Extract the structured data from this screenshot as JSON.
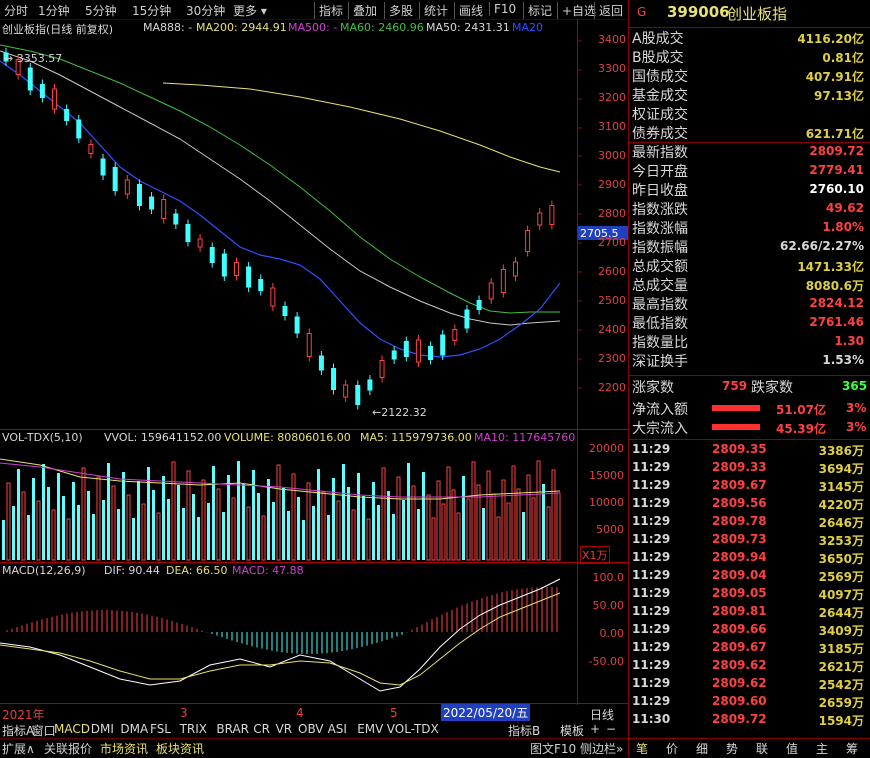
{
  "toolbar": {
    "left": [
      "分时",
      "1分钟",
      "5分钟",
      "15分钟",
      "30分钟",
      "更多"
    ],
    "right": [
      "指标",
      "叠加",
      "多股",
      "统计",
      "画线",
      "F10",
      "标记",
      "+自选",
      "返回"
    ]
  },
  "main": {
    "title": "创业板指(日线 前复权)",
    "ma888": "MA888: -",
    "ma200": "MA200: 2944.91",
    "ma500": "MA500: -",
    "ma60": "MA60: 2460.96",
    "ma50": "MA50: 2431.31",
    "ma20": "MA20",
    "yticks": [
      "3400",
      "3300",
      "3200",
      "3100",
      "3000",
      "2900",
      "2800",
      "2700",
      "2600",
      "2500",
      "2400",
      "2300",
      "2200"
    ],
    "high_label": "3353.57",
    "low_label": "2122.32",
    "current": "2705.5"
  },
  "vol": {
    "title": "VOL-TDX(5,10)",
    "vvol": "VVOL: 159641152.00",
    "volume": "VOLUME: 80806016.00",
    "ma5": "MA5: 115979736.00",
    "ma10": "MA10: 117645760.0",
    "yticks": [
      "20000",
      "15000",
      "10000",
      "5000"
    ],
    "unit": "X1万"
  },
  "macd": {
    "title": "MACD(12,26,9)",
    "dif": "DIF: 90.44",
    "dea": "DEA: 66.50",
    "macd": "MACD: 47.88",
    "yticks": [
      "100.0",
      "50.00",
      "0.00",
      "-50.00"
    ]
  },
  "xaxis": {
    "labels": [
      "2021年",
      "3",
      "4",
      "5"
    ],
    "cursor_date": "2022/05/20/五",
    "period": "日线"
  },
  "tabs": [
    "指标A",
    "窗口",
    "MACD",
    "DMI",
    "DMA",
    "FSL",
    "TRIX",
    "BRAR",
    "CR",
    "VR",
    "OBV",
    "ASI",
    "EMV",
    "VOL-TDX"
  ],
  "tabs_right": [
    "指标B",
    "模板"
  ],
  "bottom_tabs": [
    "扩展∧",
    "关联报价",
    "市场资讯",
    "板块资讯"
  ],
  "bottom_right": [
    "图文F10",
    "侧边栏»"
  ],
  "quote": {
    "prefix": "G",
    "code": "399006",
    "name": "创业板指",
    "stats": [
      {
        "label": "A股成交",
        "value": "4116.20亿",
        "color": "#e0d040"
      },
      {
        "label": "B股成交",
        "value": "0.81亿",
        "color": "#e0d040"
      },
      {
        "label": "国债成交",
        "value": "407.91亿",
        "color": "#e0d040"
      },
      {
        "label": "基金成交",
        "value": "97.13亿",
        "color": "#e0d040"
      },
      {
        "label": "权证成交",
        "value": "",
        "color": "#e0d040"
      },
      {
        "label": "债券成交",
        "value": "621.71亿",
        "color": "#e0d040"
      },
      {
        "label": "最新指数",
        "value": "2809.72",
        "color": "#ff4040"
      },
      {
        "label": "今日开盘",
        "value": "2779.41",
        "color": "#ff4040"
      },
      {
        "label": "昨日收盘",
        "value": "2760.10",
        "color": "#ffffff"
      },
      {
        "label": "指数涨跌",
        "value": "49.62",
        "color": "#ff4040"
      },
      {
        "label": "指数涨幅",
        "value": "1.80%",
        "color": "#ff4040"
      },
      {
        "label": "指数振幅",
        "value": "62.66/2.27%",
        "color": "#d8d8d8"
      },
      {
        "label": "总成交额",
        "value": "1471.33亿",
        "color": "#e0d040"
      },
      {
        "label": "总成交量",
        "value": "8080.6万",
        "color": "#e0d040"
      },
      {
        "label": "最高指数",
        "value": "2824.12",
        "color": "#ff4040"
      },
      {
        "label": "最低指数",
        "value": "2761.46",
        "color": "#ff4040"
      },
      {
        "label": "指数量比",
        "value": "1.30",
        "color": "#ff4040"
      },
      {
        "label": "深证换手",
        "value": "1.53%",
        "color": "#d8d8d8"
      }
    ],
    "up_label": "涨家数",
    "up_count": "759",
    "down_label": "跌家数",
    "down_count": "365",
    "net_in_label": "净流入额",
    "net_in_value": "51.07亿",
    "net_in_pct": "3%",
    "bulk_label": "大宗流入",
    "bulk_value": "45.39亿",
    "bulk_pct": "3%"
  },
  "trades": [
    {
      "t": "11:29",
      "p": "2809.35",
      "v": "3386万"
    },
    {
      "t": "11:29",
      "p": "2809.33",
      "v": "3694万"
    },
    {
      "t": "11:29",
      "p": "2809.67",
      "v": "3145万"
    },
    {
      "t": "11:29",
      "p": "2809.56",
      "v": "4220万"
    },
    {
      "t": "11:29",
      "p": "2809.78",
      "v": "2646万"
    },
    {
      "t": "11:29",
      "p": "2809.73",
      "v": "3253万"
    },
    {
      "t": "11:29",
      "p": "2809.94",
      "v": "3650万"
    },
    {
      "t": "11:29",
      "p": "2809.04",
      "v": "2569万"
    },
    {
      "t": "11:29",
      "p": "2809.05",
      "v": "4097万"
    },
    {
      "t": "11:29",
      "p": "2809.81",
      "v": "2644万"
    },
    {
      "t": "11:29",
      "p": "2809.66",
      "v": "3409万"
    },
    {
      "t": "11:29",
      "p": "2809.67",
      "v": "3185万"
    },
    {
      "t": "11:29",
      "p": "2809.62",
      "v": "2621万"
    },
    {
      "t": "11:29",
      "p": "2809.62",
      "v": "2542万"
    },
    {
      "t": "11:29",
      "p": "2809.60",
      "v": "2659万"
    },
    {
      "t": "11:30",
      "p": "2809.72",
      "v": "1594万"
    }
  ],
  "right_bottom_tabs": [
    "笔",
    "价",
    "细",
    "势",
    "联",
    "值",
    "主",
    "筹"
  ]
}
